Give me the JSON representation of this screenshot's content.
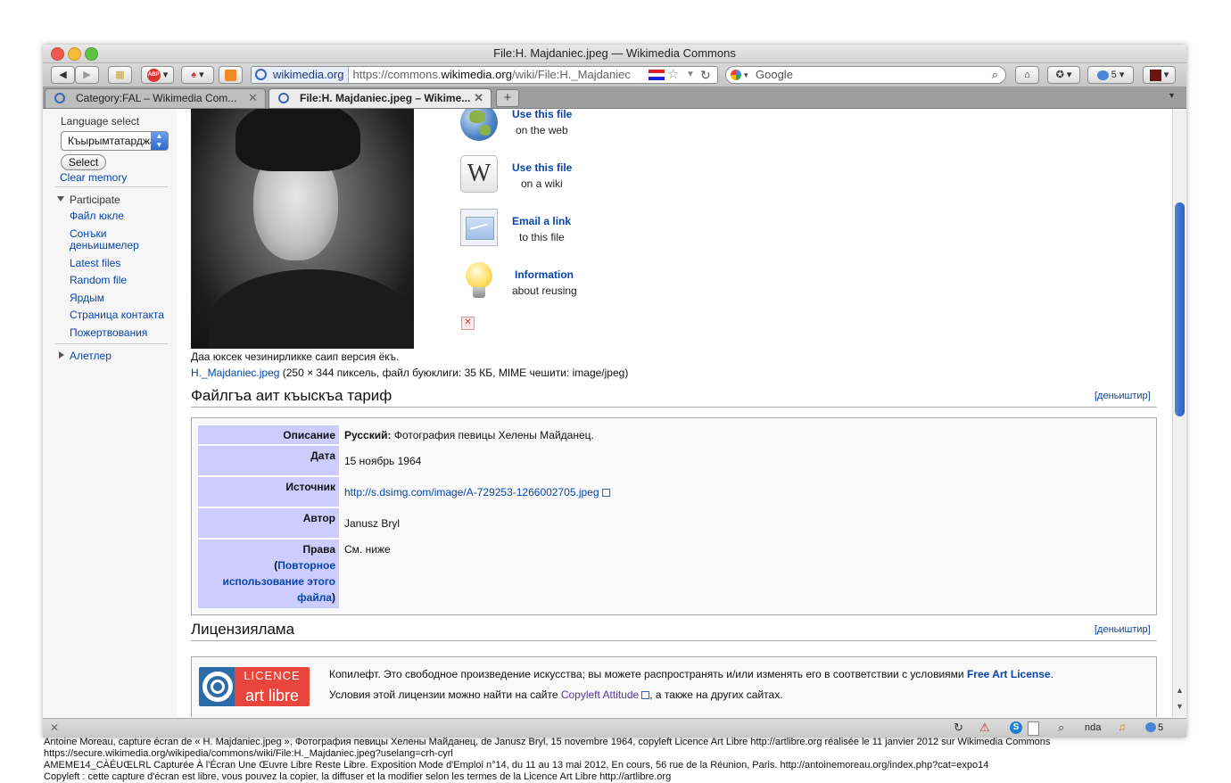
{
  "window": {
    "title": "File:H. Majdaniec.jpeg — Wikimedia Commons"
  },
  "toolbar": {
    "abp_label": "ABP",
    "site_identity": "wikimedia.org",
    "url_prefix": "https://commons.",
    "url_domain": "wikimedia.org",
    "url_rest": "/wiki/File:H._Majdaniec",
    "search_placeholder": "Google",
    "bubble_count": "5"
  },
  "tabs": [
    {
      "label": "Category:FAL – Wikimedia Com..."
    },
    {
      "label": "File:H. Majdaniec.jpeg – Wikime..."
    }
  ],
  "sidebar": {
    "language_label": "Language select",
    "language_value": "Къырымтатарджа",
    "select_button": "Select",
    "clear_memory": "Clear memory",
    "participate_heading": "Participate",
    "participate_items": [
      "Файл юкле",
      "Сонъки деньишмелер",
      "Latest files",
      "Random file",
      "Ярдым",
      "Страница контакта",
      "Пожертвования"
    ],
    "tools_heading": "Алетлер"
  },
  "reuse": [
    {
      "title": "Use this file",
      "sub": "on the web",
      "icon": "globe-icon"
    },
    {
      "title": "Use this file",
      "sub": "on a wiki",
      "icon": "wikipedia-icon"
    },
    {
      "title": "Email a link",
      "sub": "to this file",
      "icon": "email-icon"
    },
    {
      "title": "Information",
      "sub": "about reusing",
      "icon": "lightbulb-icon"
    }
  ],
  "file": {
    "no_higher_res": "Даа юксек чезинирликке саип версия ёкъ.",
    "filename_link": "H._Majdaniec.jpeg",
    "file_details": " (250 × 344 пиксель, файл буюклиги: 35 КБ, MIME чешити: image/jpeg)"
  },
  "summary": {
    "heading": "Файлгъа аит къыскъа тариф",
    "edit": "[деньиштир]",
    "rows": {
      "description_label": "Описание",
      "description_lang": "Русский:",
      "description_value": " Фотография певицы Хелены Майданец.",
      "date_label": "Дата",
      "date_value": "15 ноябрь 1964",
      "source_label": "Источник",
      "source_value": "http://s.dsimg.com/image/A-729253-1266002705.jpeg",
      "author_label": "Автор",
      "author_value": "Janusz Bryl",
      "rights_label": "Права",
      "rights_link": "Повторное использование этого файла",
      "rights_value": "См. ниже"
    }
  },
  "licensing": {
    "heading": "Лицензиялама",
    "edit": "[деньиштир]",
    "logo_top": "LICENCE",
    "logo_bottom": "art libre",
    "line1": "Копилефт. Это свободное произведение искусства; вы можете распространять и/или изменять его в соответствии с условиями ",
    "line1_link": "Free Art License",
    "line1_end": ".",
    "line2": "Условия этой лицензии можно найти на сайте ",
    "line2_link": "Copyleft Attitude",
    "line2_end": ", а также на других сайтах."
  },
  "statusbar": {
    "right_text": "nda",
    "bubble_count": "5"
  },
  "caption": {
    "line1": "Antoine Moreau, capture écran de « H. Majdaniec.jpeg », Фотография певицы Хелены Майданец, de Janusz Bryl, 15 novembre 1964, copyleft Licence Art Libre http://artlibre.org réalisée le 11 janvier 2012 sur Wikimedia Commons",
    "line2": "https://secure.wikimedia.org/wikipedia/commons/wiki/File:H._Majdaniec.jpeg?uselang=crh-cyrl",
    "line3": "AMEME14_CÀÉUŒLRL Capturée À l'Écran Une Œuvre Libre Reste Libre. Exposition Mode d'Emploi n°14, du 11 au 13 mai 2012, En cours, 56 rue de la Réunion, Paris. http://antoinemoreau.org/index.php?cat=expo14",
    "line4": "Copyleft : cette capture d'écran est libre, vous pouvez la copier, la diffuser et la modifier selon les termes de la Licence Art Libre http://artlibre.org"
  }
}
